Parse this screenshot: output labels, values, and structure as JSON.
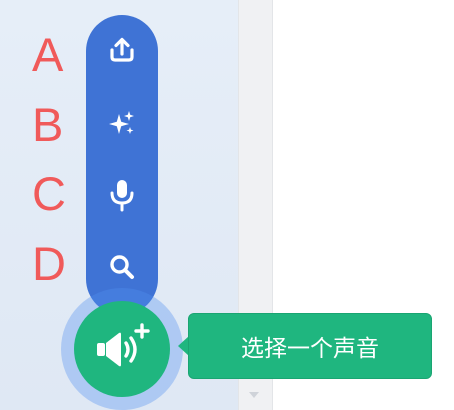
{
  "labels": {
    "a": "A",
    "b": "B",
    "c": "C",
    "d": "D"
  },
  "menu": {
    "items": [
      {
        "icon": "upload-icon",
        "action": "upload-sound"
      },
      {
        "icon": "sparkle-icon",
        "action": "surprise"
      },
      {
        "icon": "microphone-icon",
        "action": "record"
      },
      {
        "icon": "search-icon",
        "action": "choose-sound"
      }
    ],
    "fab_icon": "speaker-add-icon"
  },
  "tooltip": {
    "text": "选择一个声音"
  },
  "colors": {
    "menu_blue": "#3f73d5",
    "fab_green": "#1fb67f",
    "label_red": "#f05a5a",
    "panel_bg": "#e3ebf6"
  }
}
